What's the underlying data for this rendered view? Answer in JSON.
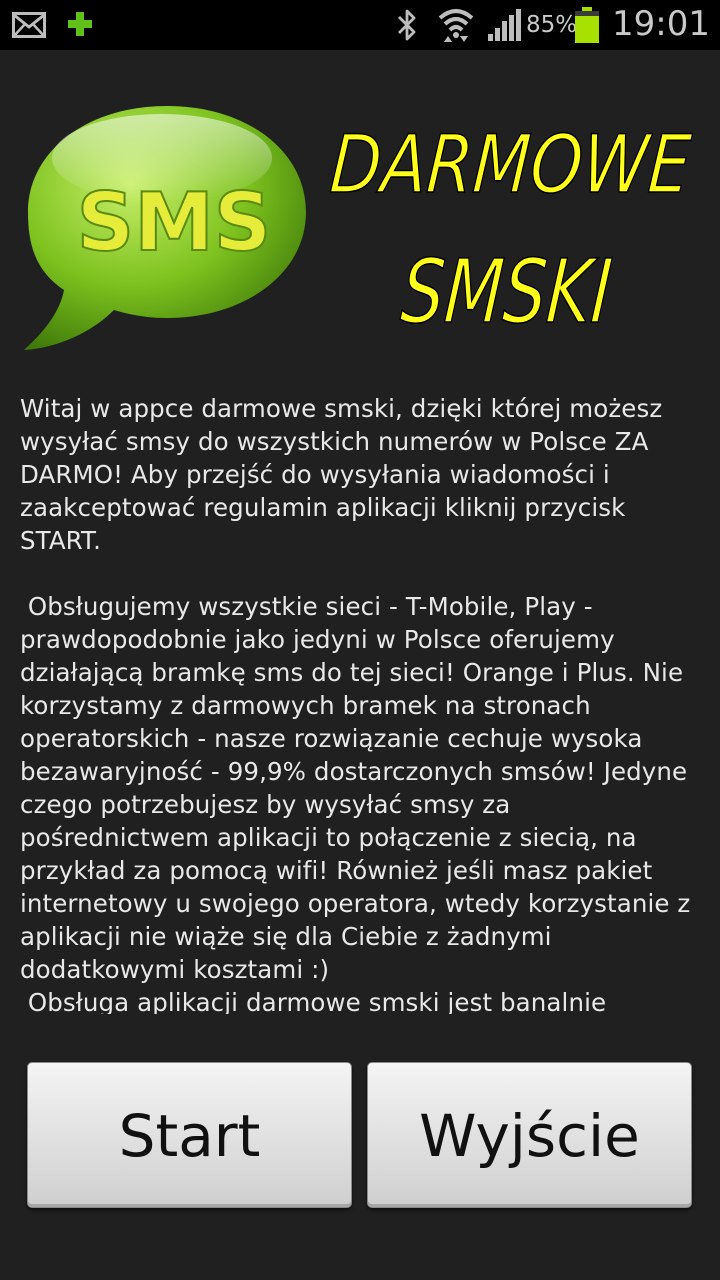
{
  "status_bar": {
    "battery_percent": "85%",
    "time": "19:01",
    "icons": [
      "mail-icon",
      "plus-icon",
      "bluetooth-icon",
      "wifi-icon",
      "signal-icon",
      "battery-icon"
    ],
    "battery_level": 0.85,
    "battery_color": "#a8e000"
  },
  "logo": {
    "badge_text": "SMS",
    "title_line1": "DARMOWE",
    "title_line2": "SMSKI",
    "bubble_color": "#7dc21e",
    "title_color": "#ffff1a"
  },
  "description": {
    "paragraph1": "Witaj w appce darmowe smski, dzięki której możesz wysyłać smsy do wszystkich numerów w Polsce ZA DARMO! Aby przejść do wysyłania wiadomości i zaakceptować regulamin aplikacji kliknij przycisk START.",
    "paragraph2": " Obsługujemy wszystkie sieci - T-Mobile, Play - prawdopodobnie jako jedyni w Polsce oferujemy działającą bramkę sms do tej sieci! Orange i Plus. Nie korzystamy z darmowych bramek na stronach operatorskich - nasze rozwiązanie cechuje wysoka bezawaryjność - 99,9% dostarczonych smsów! Jedyne czego potrzebujesz by wysyłać smsy za pośrednictwem aplikacji to połączenie z siecią, na przykład za pomocą wifi! Również jeśli masz pakiet internetowy u swojego operatora, wtedy korzystanie z aplikacji nie wiąże się dla Ciebie z żadnymi dodatkowymi kosztami :)",
    "paragraph3": " Obsługa aplikacji darmowe smski jest banalnie"
  },
  "buttons": {
    "start_label": "Start",
    "exit_label": "Wyjście"
  }
}
